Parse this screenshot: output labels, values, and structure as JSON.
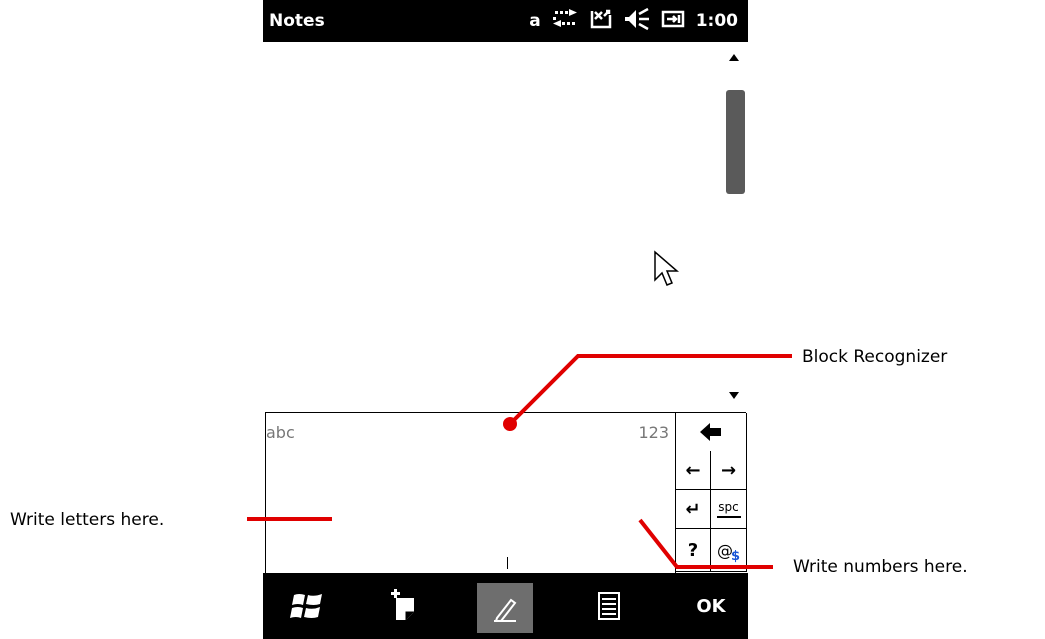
{
  "status_bar": {
    "app_title": "Notes",
    "input_mode": "a",
    "time": "1:00"
  },
  "recognizer": {
    "letters_zone_label": "abc",
    "numbers_zone_label": "123"
  },
  "keypad": {
    "backspace": "←",
    "left": "←",
    "right": "→",
    "enter": "↵",
    "space_label": "spc",
    "symbols": "?",
    "at_label": "@",
    "dollar_label": "$"
  },
  "toolbar": {
    "ok_label": "OK"
  },
  "annotations": {
    "block_recognizer": "Block Recognizer",
    "letters": "Write letters here.",
    "numbers": "Write numbers here."
  },
  "colors": {
    "annotation_line": "#e00000",
    "bar_background": "#000000",
    "pen_selected": "#6e6e6e"
  }
}
